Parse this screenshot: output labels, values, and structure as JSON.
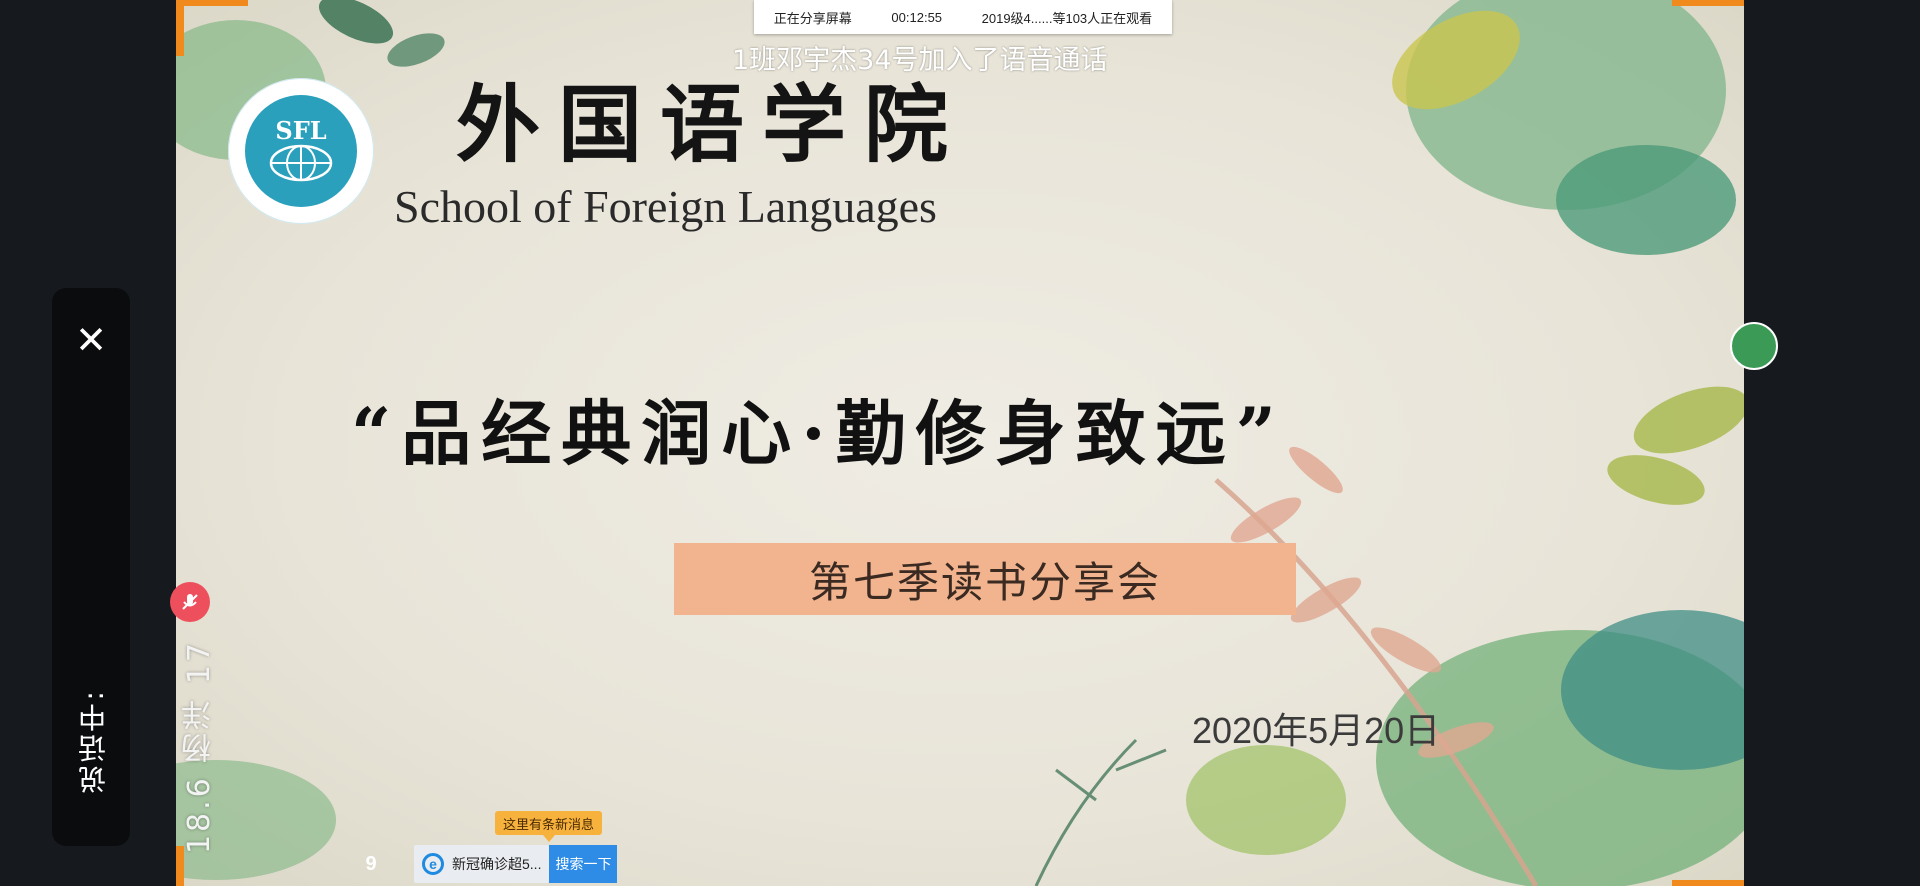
{
  "share_bar": {
    "status": "正在分享屏幕",
    "elapsed": "00:12:55",
    "viewers": "2019级4......等103人正在观看"
  },
  "notification": {
    "join_message": "1班邓宇杰34号加入了语音通话"
  },
  "call_panel": {
    "close_label": "✕",
    "speaking_label": "说话中:",
    "speaker_name": "18.6 杨洋 17"
  },
  "slide": {
    "logo_text": "SFL",
    "title_cn": "外国语学院",
    "title_en": "School of Foreign Languages",
    "motto": "“品经典润心·勤修身致远”",
    "event": "第七季读书分享会",
    "date": "2020年5月20日"
  },
  "taskbar": {
    "icon_glyph": "9",
    "tab_label": "新冠确诊超5...",
    "search_button": "搜索一下",
    "tooltip": "这里有条新消息"
  },
  "colors": {
    "accent_orange": "#f08a1c",
    "banner": "#f2b48e",
    "logo_blue": "#2aa0bd",
    "record_red": "#ee4f5d"
  }
}
